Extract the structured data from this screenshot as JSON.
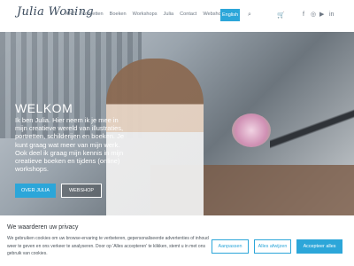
{
  "header": {
    "logo": "Julia Woning",
    "nav": [
      "ART",
      "Portretten",
      "Boeken",
      "Workshops",
      "Julia",
      "Contact",
      "Webshop"
    ],
    "lang_button": "English",
    "icons": [
      "search-icon",
      "cart-icon",
      "facebook-icon",
      "instagram-icon",
      "youtube-icon",
      "linkedin-icon"
    ]
  },
  "hero": {
    "title": "WELKOM",
    "text": "Ik ben Julia. Hier neem ik je mee in mijn creatieve wereld van illustraties, portretten, schilderijen en boeken. Je kunt graag wat meer van mijn werk. Ook deel ik graag mijn kennis in mijn creatieve boeken en tijdens (online) workshops.",
    "button_about": "OVER JULIA",
    "button_shop": "WEBSHOP"
  },
  "cookie": {
    "title": "We waarderen uw privacy",
    "text": "We gebruiken cookies om uw browse-ervaring te verbeteren, gepersonaliseerde advertenties of inhoud weer te geven en ons verkeer te analyseren. Door op 'Alles accepteren' te klikken, stemt u in met ons gebruik van cookies.",
    "adjust": "Aanpassen",
    "reject": "Alles afwijzen",
    "accept": "Accepteer alles"
  },
  "colors": {
    "accent": "#2ca6d9"
  }
}
